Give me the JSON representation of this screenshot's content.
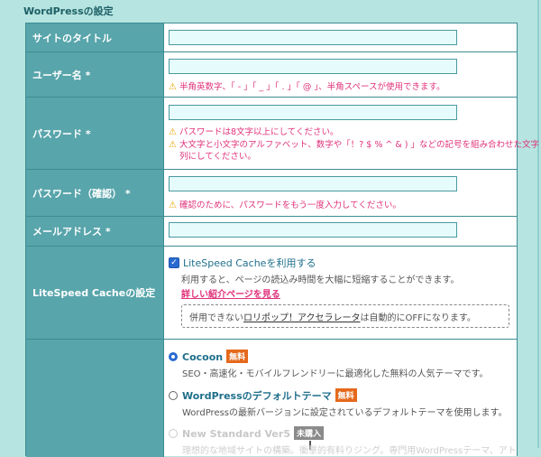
{
  "section": {
    "title": "WordPressの設定"
  },
  "site_title": {
    "label": "サイトのタイトル",
    "value": ""
  },
  "username": {
    "label": "ユーザー名 *",
    "value": "",
    "hint": "半角英数字、「 - 」「 _ 」「 . 」「 @ 」、半角スペースが使用できます。"
  },
  "password": {
    "label": "パスワード *",
    "value": "",
    "hint1": "パスワードは8文字以上にしてください。",
    "hint2_line1": "大文字と小文字のアルファベット、数字や「！? $ % ^ & ) 」などの記号を組み合わせた文字",
    "hint2_line2": "列にしてください。"
  },
  "password_confirm": {
    "label": "パスワード（確認） *",
    "value": "",
    "hint": "確認のために、パスワードをもう一度入力してください。"
  },
  "email": {
    "label": "メールアドレス *",
    "value": ""
  },
  "litespeed": {
    "label": "LiteSpeed Cacheの設定",
    "checkbox_label": "LiteSpeed Cacheを利用する",
    "checked": true,
    "description": "利用すると、ページの読込み時間を大幅に短縮することができます。",
    "link": "詳しい紹介ページを見る",
    "note_prefix": "併用できない",
    "note_link": "ロリポップ！アクセラレータ",
    "note_suffix": "は自動的にOFFになります。"
  },
  "theme": {
    "label": "",
    "options": [
      {
        "name": "Cocoon",
        "badge": "無料",
        "description": "SEO・高速化・モバイルフレンドリーに最適化した無料の人気テーマです。",
        "selected": true,
        "disabled": false
      },
      {
        "name": "WordPressのデフォルトテーマ",
        "badge": "無料",
        "description": "WordPressの最新バージョンに設定されているデフォルトテーマを使用します。",
        "selected": false,
        "disabled": false
      },
      {
        "name": "New Standard Ver5",
        "badge": "未購入",
        "description": "理想的な地域サイトの構築。衝撃的有料りジング。専門用WordPressテーマ、アト",
        "selected": false,
        "disabled": true
      }
    ]
  },
  "colors": {
    "accent": "#58a5ab",
    "border": "#3d8d93",
    "warning": "#e0317a",
    "background": "#b6e4e0"
  }
}
